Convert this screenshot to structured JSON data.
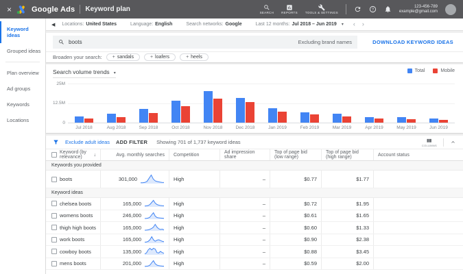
{
  "glyphs": {
    "close": "×",
    "back": "◀",
    "prev": "‹",
    "next": "›",
    "dropdown": "▾",
    "sort_desc": "↓"
  },
  "colors": {
    "topbar_bg": "#58585b",
    "link_blue": "#1a73e8",
    "total_blue": "#4285f4",
    "mobile_red": "#ea4335",
    "text_dark": "#3c4043",
    "text_gray": "#5f6368"
  },
  "topbar": {
    "brand": "Google Ads",
    "page_title": "Keyword plan",
    "nav": [
      {
        "label": "SEARCH"
      },
      {
        "label": "REPORTS"
      },
      {
        "label": "TOOLS & SETTINGS"
      }
    ],
    "account_id": "123-456-789",
    "account_email": "example@gmail.com"
  },
  "settingsbar": {
    "items": [
      {
        "label": "Locations:",
        "value": "United States"
      },
      {
        "label": "Language:",
        "value": "English"
      },
      {
        "label": "Search networks:",
        "value": "Google"
      },
      {
        "label": "Last 12 months:",
        "value": "Jul 2018 – Jun 2019",
        "has_dropdown": true
      }
    ]
  },
  "sidebar": {
    "items": [
      {
        "label": "Keyword ideas",
        "active": true
      },
      {
        "label": "Grouped ideas",
        "divider_after": true
      },
      {
        "label": "Plan overview"
      },
      {
        "label": "Ad groups"
      },
      {
        "label": "Keywords"
      },
      {
        "label": "Locations"
      }
    ]
  },
  "search": {
    "query": "boots",
    "note": "Excluding brand names",
    "download_label": "DOWNLOAD KEYWORD IDEAS"
  },
  "broaden": {
    "label": "Broaden your search:",
    "chips": [
      "sandals",
      "loafers",
      "heels"
    ]
  },
  "chart_data": {
    "type": "bar",
    "title": "Search volume trends",
    "categories": [
      "Jul 2018",
      "Aug 2018",
      "Sep 2018",
      "Oct 2018",
      "Nov 2018",
      "Dec 2018",
      "Jan 2019",
      "Feb 2019",
      "Mar 2019",
      "Apr 2019",
      "May 2019",
      "Jun 2019"
    ],
    "series": [
      {
        "name": "Total",
        "color": "#4285f4",
        "values": [
          3.8,
          5.6,
          8.6,
          13.9,
          20.2,
          15.8,
          9.0,
          6.8,
          5.6,
          3.3,
          3.3,
          2.6
        ]
      },
      {
        "name": "Mobile",
        "color": "#ea4335",
        "values": [
          2.7,
          3.6,
          6.3,
          10.4,
          15.3,
          13.3,
          7.1,
          5.2,
          4.1,
          2.6,
          2.2,
          1.8
        ]
      }
    ],
    "unit": "M (millions of searches)",
    "ylim": [
      0,
      25
    ],
    "y_ticks": [
      "25M",
      "12.5M",
      "0"
    ],
    "grid": "horizontal",
    "legend_position": "top-right"
  },
  "filterbar": {
    "exclude_label": "Exclude adult ideas",
    "add_filter_label": "ADD FILTER",
    "showing_text": "Showing 701 of 1,737 keyword ideas",
    "columns_label": "COLUMNS"
  },
  "table": {
    "columns": [
      {
        "label": "Keyword (by relevance)",
        "sorted": true
      },
      {
        "label": "Avg. monthly searches",
        "align": "right"
      },
      {
        "label": "Competition",
        "align": "left"
      },
      {
        "label": "Ad impression share",
        "align": "right"
      },
      {
        "label": "Top of page bid (low range)",
        "align": "right"
      },
      {
        "label": "Top of page bid (high range)",
        "align": "right"
      },
      {
        "label": "Account status",
        "align": "left"
      }
    ],
    "sections": [
      {
        "title": "Keywords you provided",
        "rows": [
          {
            "keyword": "boots",
            "avg_monthly_searches": "301,000",
            "competition": "High",
            "ad_impression_share": "–",
            "top_of_page_bid_low": "$0.77",
            "top_of_page_bid_high": "$1.77",
            "account_status": "",
            "trend": [
              0.5,
              0.6,
              0.9,
              2,
              5.5,
              9,
              4.5,
              2.5,
              1.8,
              1.3,
              1,
              0.8
            ]
          }
        ]
      },
      {
        "title": "Keyword ideas",
        "rows": [
          {
            "keyword": "chelsea boots",
            "avg_monthly_searches": "165,000",
            "competition": "High",
            "ad_impression_share": "–",
            "top_of_page_bid_low": "$0.72",
            "top_of_page_bid_high": "$1.95",
            "account_status": "",
            "trend": [
              0.8,
              1,
              1.5,
              3,
              6,
              9,
              5,
              3,
              2,
              1.5,
              1.2,
              1
            ]
          },
          {
            "keyword": "womens boots",
            "avg_monthly_searches": "246,000",
            "competition": "High",
            "ad_impression_share": "–",
            "top_of_page_bid_low": "$0.61",
            "top_of_page_bid_high": "$1.65",
            "account_status": "",
            "trend": [
              0.6,
              0.8,
              1.2,
              2.5,
              6,
              9,
              4,
              2,
              1.5,
              1.2,
              1,
              0.8
            ]
          },
          {
            "keyword": "thigh high boots",
            "avg_monthly_searches": "165,000",
            "competition": "High",
            "ad_impression_share": "–",
            "top_of_page_bid_low": "$0.60",
            "top_of_page_bid_high": "$1.33",
            "account_status": "",
            "trend": [
              0.5,
              0.6,
              1,
              1.8,
              3,
              5,
              9,
              5,
              2.5,
              1.5,
              2,
              1
            ]
          },
          {
            "keyword": "work boots",
            "avg_monthly_searches": "165,000",
            "competition": "High",
            "ad_impression_share": "–",
            "top_of_page_bid_low": "$0.90",
            "top_of_page_bid_high": "$2.38",
            "account_status": "",
            "trend": [
              1,
              1.2,
              2,
              4,
              8,
              4,
              2,
              3.5,
              4,
              3,
              2,
              1.5
            ]
          },
          {
            "keyword": "cowboy boots",
            "avg_monthly_searches": "135,000",
            "competition": "High",
            "ad_impression_share": "–",
            "top_of_page_bid_low": "$0.88",
            "top_of_page_bid_high": "$3.45",
            "account_status": "",
            "trend": [
              0.8,
              2,
              6,
              8,
              6,
              8,
              7,
              2.5,
              2,
              4,
              2.5,
              1.5
            ]
          },
          {
            "keyword": "mens boots",
            "avg_monthly_searches": "201,000",
            "competition": "High",
            "ad_impression_share": "–",
            "top_of_page_bid_low": "$0.59",
            "top_of_page_bid_high": "$2.00",
            "account_status": "",
            "trend": [
              0.7,
              0.9,
              1.3,
              2.5,
              6,
              9,
              4.5,
              2.5,
              1.8,
              1.4,
              1.1,
              0.9
            ]
          }
        ]
      }
    ]
  }
}
